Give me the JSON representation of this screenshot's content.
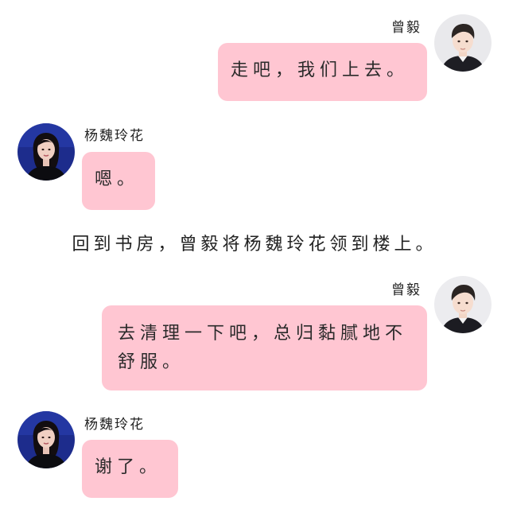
{
  "participants": {
    "zeng_yi": {
      "name": "曾毅",
      "avatar_icon": "male-portrait-icon"
    },
    "yang_weilinghua": {
      "name": "杨魏玲花",
      "avatar_icon": "female-portrait-icon"
    }
  },
  "messages": [
    {
      "sender": "曾毅",
      "side": "right",
      "text": "走吧，我们上去。"
    },
    {
      "sender": "杨魏玲花",
      "side": "left",
      "text": "嗯。"
    },
    {
      "sender": "曾毅",
      "side": "right",
      "text": "去清理一下吧，总归黏腻地不舒服。"
    },
    {
      "sender": "杨魏玲花",
      "side": "left",
      "text": "谢了。"
    }
  ],
  "narration": "回到书房，曾毅将杨魏玲花领到楼上。",
  "colors": {
    "bubble": "#ffc6d2",
    "background": "#ffffff",
    "text": "#2a2a2a"
  }
}
